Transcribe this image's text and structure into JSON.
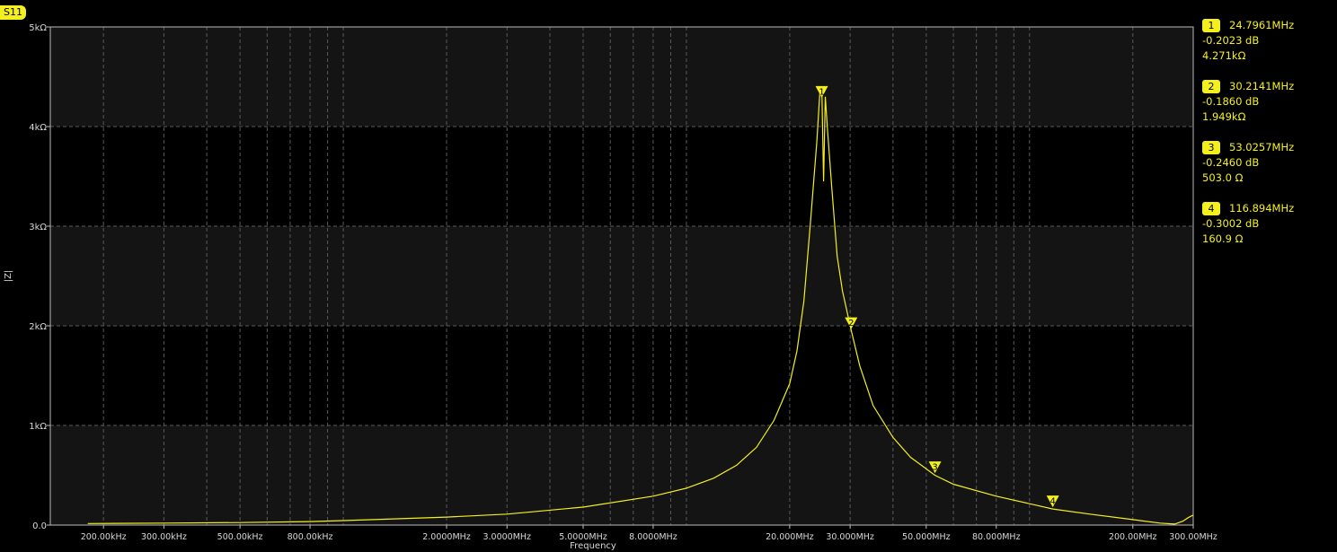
{
  "trace": {
    "label": "S11",
    "color": "#f4f01e"
  },
  "markers": [
    {
      "id": "1",
      "freq": "24.7961MHz",
      "db": "-0.2023 dB",
      "impedance": "4.271kΩ"
    },
    {
      "id": "2",
      "freq": "30.2141MHz",
      "db": "-0.1860 dB",
      "impedance": "1.949kΩ"
    },
    {
      "id": "3",
      "freq": "53.0257MHz",
      "db": "-0.2460 dB",
      "impedance": "503.0 Ω"
    },
    {
      "id": "4",
      "freq": "116.894MHz",
      "db": "-0.3002 dB",
      "impedance": "160.9 Ω"
    }
  ],
  "chart_data": {
    "type": "line",
    "xlabel": "Frequency",
    "ylabel": "|Z|",
    "x_scale": "log",
    "xlim": [
      140000,
      300000000
    ],
    "ylim": [
      0,
      5000
    ],
    "grid": true,
    "colors": {
      "trace": "#f4f01e",
      "band": "#141414",
      "grid": "#5a5a5a",
      "axis": "#bcbcbc"
    },
    "y_ticks": [
      {
        "value": 0,
        "label": "0.0"
      },
      {
        "value": 1000,
        "label": "1kΩ"
      },
      {
        "value": 2000,
        "label": "2kΩ"
      },
      {
        "value": 3000,
        "label": "3kΩ"
      },
      {
        "value": 4000,
        "label": "4kΩ"
      },
      {
        "value": 5000,
        "label": "5kΩ"
      }
    ],
    "x_ticks": [
      {
        "value": 200000,
        "label": "200.00kHz"
      },
      {
        "value": 300000,
        "label": "300.00kHz"
      },
      {
        "value": 500000,
        "label": "500.00kHz"
      },
      {
        "value": 800000,
        "label": "800.00kHz"
      },
      {
        "value": 2000000,
        "label": "2.0000MHz"
      },
      {
        "value": 3000000,
        "label": "3.0000MHz"
      },
      {
        "value": 5000000,
        "label": "5.0000MHz"
      },
      {
        "value": 8000000,
        "label": "8.0000MHz"
      },
      {
        "value": 20000000,
        "label": "20.000MHz"
      },
      {
        "value": 30000000,
        "label": "30.000MHz"
      },
      {
        "value": 50000000,
        "label": "50.000MHz"
      },
      {
        "value": 80000000,
        "label": "80.000MHz"
      },
      {
        "value": 200000000,
        "label": "200.00MHz"
      },
      {
        "value": 300000000,
        "label": "300.00MHz"
      }
    ],
    "series": [
      {
        "x": [
          180000,
          300000,
          500000,
          800000,
          1000000,
          2000000,
          3000000,
          5000000,
          8000000,
          10000000,
          12000000,
          14000000,
          16000000,
          18000000,
          20000000,
          21000000,
          22000000,
          23000000,
          24000000,
          24500000,
          24800000,
          25100000,
          25400000,
          25800000,
          26500000,
          27500000,
          28500000,
          30200000,
          32000000,
          35000000,
          40000000,
          45000000,
          53000000,
          60000000,
          80000000,
          117000000,
          150000000,
          200000000,
          240000000,
          265000000,
          280000000,
          290000000,
          300000000
        ],
        "y": [
          15,
          20,
          25,
          35,
          45,
          80,
          110,
          180,
          290,
          370,
          470,
          600,
          780,
          1050,
          1420,
          1750,
          2250,
          3050,
          3850,
          4350,
          4400,
          3450,
          4300,
          3950,
          3400,
          2700,
          2350,
          1960,
          1600,
          1200,
          880,
          680,
          500,
          410,
          290,
          161,
          110,
          55,
          20,
          10,
          40,
          75,
          100
        ]
      }
    ],
    "markers": [
      {
        "id": "1",
        "x": 24800000,
        "y": 4271
      },
      {
        "id": "2",
        "x": 30214100,
        "y": 1949
      },
      {
        "id": "3",
        "x": 53025700,
        "y": 503
      },
      {
        "id": "4",
        "x": 116894000,
        "y": 160.9
      }
    ]
  }
}
